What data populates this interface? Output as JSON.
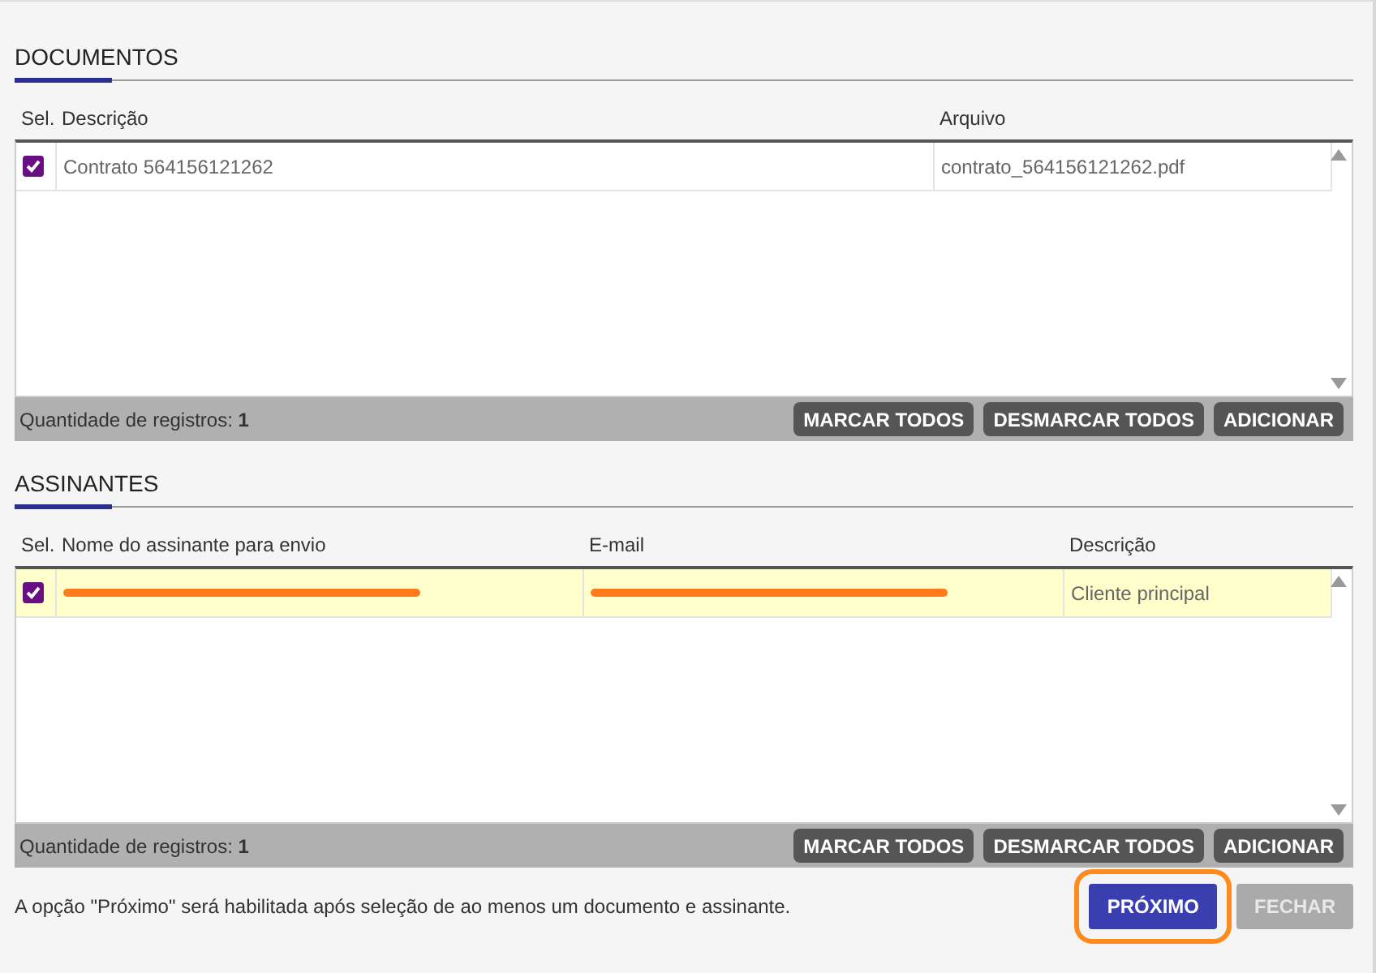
{
  "sections": [
    {
      "title": "DOCUMENTOS",
      "columns": [
        {
          "label": "Sel."
        },
        {
          "label": "Descrição"
        },
        {
          "label": "Arquivo"
        }
      ],
      "rows": [
        {
          "highlighted": false,
          "cells": [
            {
              "kind": "check",
              "checked": true
            },
            {
              "kind": "text",
              "text": "Contrato 564156121262"
            },
            {
              "kind": "text",
              "text": "contrato_564156121262.pdf"
            }
          ]
        }
      ],
      "count_label": "Quantidade de registros:",
      "count": "1",
      "buttons": [
        "MARCAR TODOS",
        "DESMARCAR TODOS",
        "ADICIONAR"
      ]
    },
    {
      "title": "ASSINANTES",
      "columns": [
        {
          "label": "Sel."
        },
        {
          "label": "Nome do assinante para envio"
        },
        {
          "label": "E-mail"
        },
        {
          "label": "Descrição"
        }
      ],
      "rows": [
        {
          "highlighted": true,
          "cells": [
            {
              "kind": "check",
              "checked": true
            },
            {
              "kind": "redacted"
            },
            {
              "kind": "redacted"
            },
            {
              "kind": "text",
              "text": "Cliente principal"
            }
          ]
        }
      ],
      "count_label": "Quantidade de registros:",
      "count": "1",
      "buttons": [
        "MARCAR TODOS",
        "DESMARCAR TODOS",
        "ADICIONAR"
      ]
    }
  ],
  "footer": {
    "note": "A opção \"Próximo\" será habilitada após seleção de ao menos um documento e assinante.",
    "buttons": [
      {
        "label": "PRÓXIMO",
        "disabled": false,
        "highlight": true
      },
      {
        "label": "FECHAR",
        "disabled": true,
        "highlight": false
      }
    ]
  }
}
